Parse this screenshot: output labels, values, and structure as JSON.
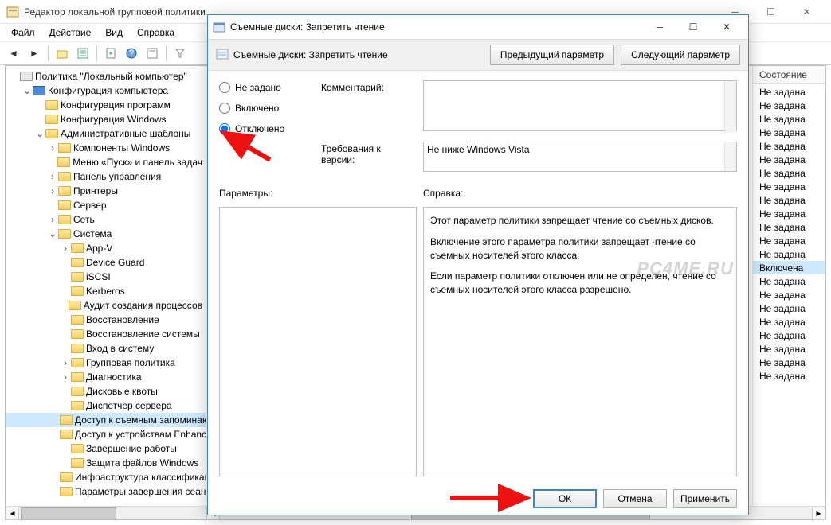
{
  "main_window": {
    "title": "Редактор локальной групповой политики",
    "menu": {
      "file": "Файл",
      "action": "Действие",
      "view": "Вид",
      "help": "Справка"
    }
  },
  "tree": {
    "root": "Политика \"Локальный компьютер\"",
    "comp_cfg": "Конфигурация компьютера",
    "items": [
      {
        "l": 2,
        "t": "",
        "label": "Конфигурация программ"
      },
      {
        "l": 2,
        "t": "",
        "label": "Конфигурация Windows"
      },
      {
        "l": 2,
        "t": "v",
        "label": "Административные шаблоны"
      },
      {
        "l": 3,
        "t": ">",
        "label": "Компоненты Windows"
      },
      {
        "l": 3,
        "t": "",
        "label": "Меню «Пуск» и панель задач"
      },
      {
        "l": 3,
        "t": ">",
        "label": "Панель управления"
      },
      {
        "l": 3,
        "t": ">",
        "label": "Принтеры"
      },
      {
        "l": 3,
        "t": "",
        "label": "Сервер"
      },
      {
        "l": 3,
        "t": ">",
        "label": "Сеть"
      },
      {
        "l": 3,
        "t": "v",
        "label": "Система"
      },
      {
        "l": 4,
        "t": ">",
        "label": "App-V"
      },
      {
        "l": 4,
        "t": "",
        "label": "Device Guard"
      },
      {
        "l": 4,
        "t": "",
        "label": "iSCSI"
      },
      {
        "l": 4,
        "t": "",
        "label": "Kerberos"
      },
      {
        "l": 4,
        "t": "",
        "label": "Аудит создания процессов"
      },
      {
        "l": 4,
        "t": "",
        "label": "Восстановление"
      },
      {
        "l": 4,
        "t": "",
        "label": "Восстановление системы"
      },
      {
        "l": 4,
        "t": "",
        "label": "Вход в систему"
      },
      {
        "l": 4,
        "t": ">",
        "label": "Групповая политика"
      },
      {
        "l": 4,
        "t": ">",
        "label": "Диагностика"
      },
      {
        "l": 4,
        "t": "",
        "label": "Дисковые квоты"
      },
      {
        "l": 4,
        "t": "",
        "label": "Диспетчер сервера"
      },
      {
        "l": 4,
        "t": "",
        "label": "Доступ к съемным запоминающим устройствам",
        "sel": true
      },
      {
        "l": 4,
        "t": "",
        "label": "Доступ к устройствам Enhanced Storage"
      },
      {
        "l": 4,
        "t": "",
        "label": "Завершение работы"
      },
      {
        "l": 4,
        "t": "",
        "label": "Защита файлов Windows"
      },
      {
        "l": 4,
        "t": "",
        "label": "Инфраструктура классификации"
      },
      {
        "l": 4,
        "t": "",
        "label": "Параметры завершения сеанса"
      }
    ]
  },
  "state_col": {
    "header": "Состояние",
    "rows": [
      "Не задана",
      "Не задана",
      "Не задана",
      "Не задана",
      "Не задана",
      "Не задана",
      "Не задана",
      "Не задана",
      "Не задана",
      "Не задана",
      "Не задана",
      "Не задана",
      "Не задана",
      {
        "text": "Включена",
        "sel": true
      },
      "Не задана",
      "Не задана",
      "Не задана",
      "Не задана",
      "Не задана",
      "Не задана",
      "Не задана",
      "Не задана"
    ]
  },
  "dialog": {
    "title": "Съемные диски: Запретить чтение",
    "policy_name": "Съемные диски: Запретить чтение",
    "nav_prev": "Предыдущий параметр",
    "nav_next": "Следующий параметр",
    "radio": {
      "not_configured": "Не задано",
      "enabled": "Включено",
      "disabled": "Отключено",
      "selected": "disabled"
    },
    "label_comment": "Комментарий:",
    "comment": "",
    "label_requirements": "Требования к версии:",
    "requirements": "Не ниже Windows Vista",
    "label_params": "Параметры:",
    "label_help": "Справка:",
    "help": [
      "Этот параметр политики запрещает чтение со съемных дисков.",
      "Включение этого параметра политики запрещает чтение со съемных носителей этого класса.",
      "Если параметр политики отключен или не определен, чтение со съемных носителей этого класса разрешено."
    ],
    "buttons": {
      "ok": "ОК",
      "cancel": "Отмена",
      "apply": "Применить"
    }
  },
  "watermark": "PC4ME.RU"
}
